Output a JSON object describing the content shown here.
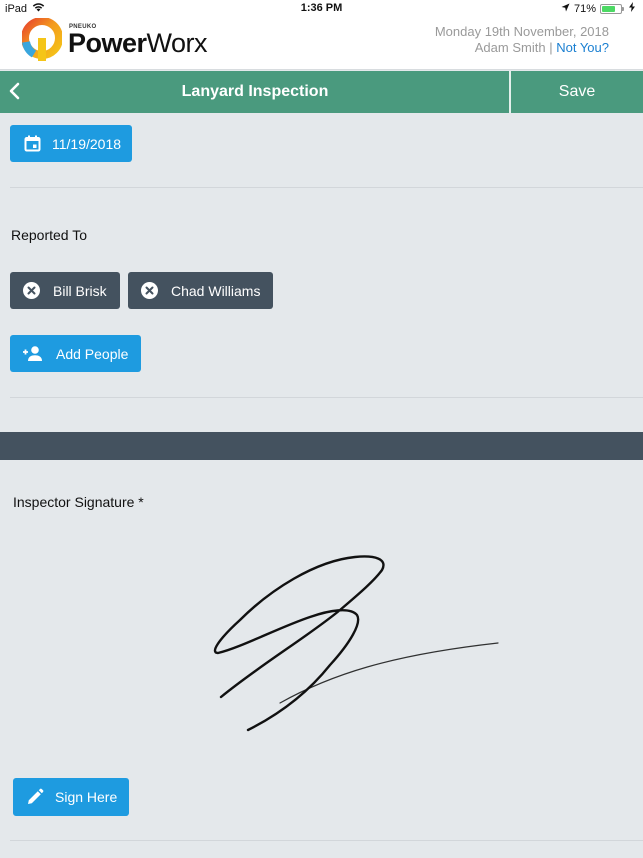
{
  "status_bar": {
    "device": "iPad",
    "time": "1:36 PM",
    "battery_percent": "71%",
    "battery_level": 0.71
  },
  "header": {
    "brand_small": "PNEUKO",
    "brand_bold": "Power",
    "brand_light": "Worx",
    "date": "Monday 19th November, 2018",
    "user": "Adam Smith",
    "separator": "|",
    "not_you": "Not You?"
  },
  "navbar": {
    "title": "Lanyard Inspection",
    "save_label": "Save"
  },
  "form": {
    "date_value": "11/19/2018",
    "reported_to_label": "Reported To",
    "reported_to": [
      {
        "name": "Bill Brisk"
      },
      {
        "name": "Chad Williams"
      }
    ],
    "add_people_label": "Add People",
    "signature_label": "Inspector Signature *",
    "sign_here_label": "Sign Here"
  },
  "colors": {
    "navbar": "#4a9a7e",
    "button": "#1e9be0",
    "chip": "#44525f",
    "link": "#1a7fd1",
    "background": "#e4e8eb"
  }
}
